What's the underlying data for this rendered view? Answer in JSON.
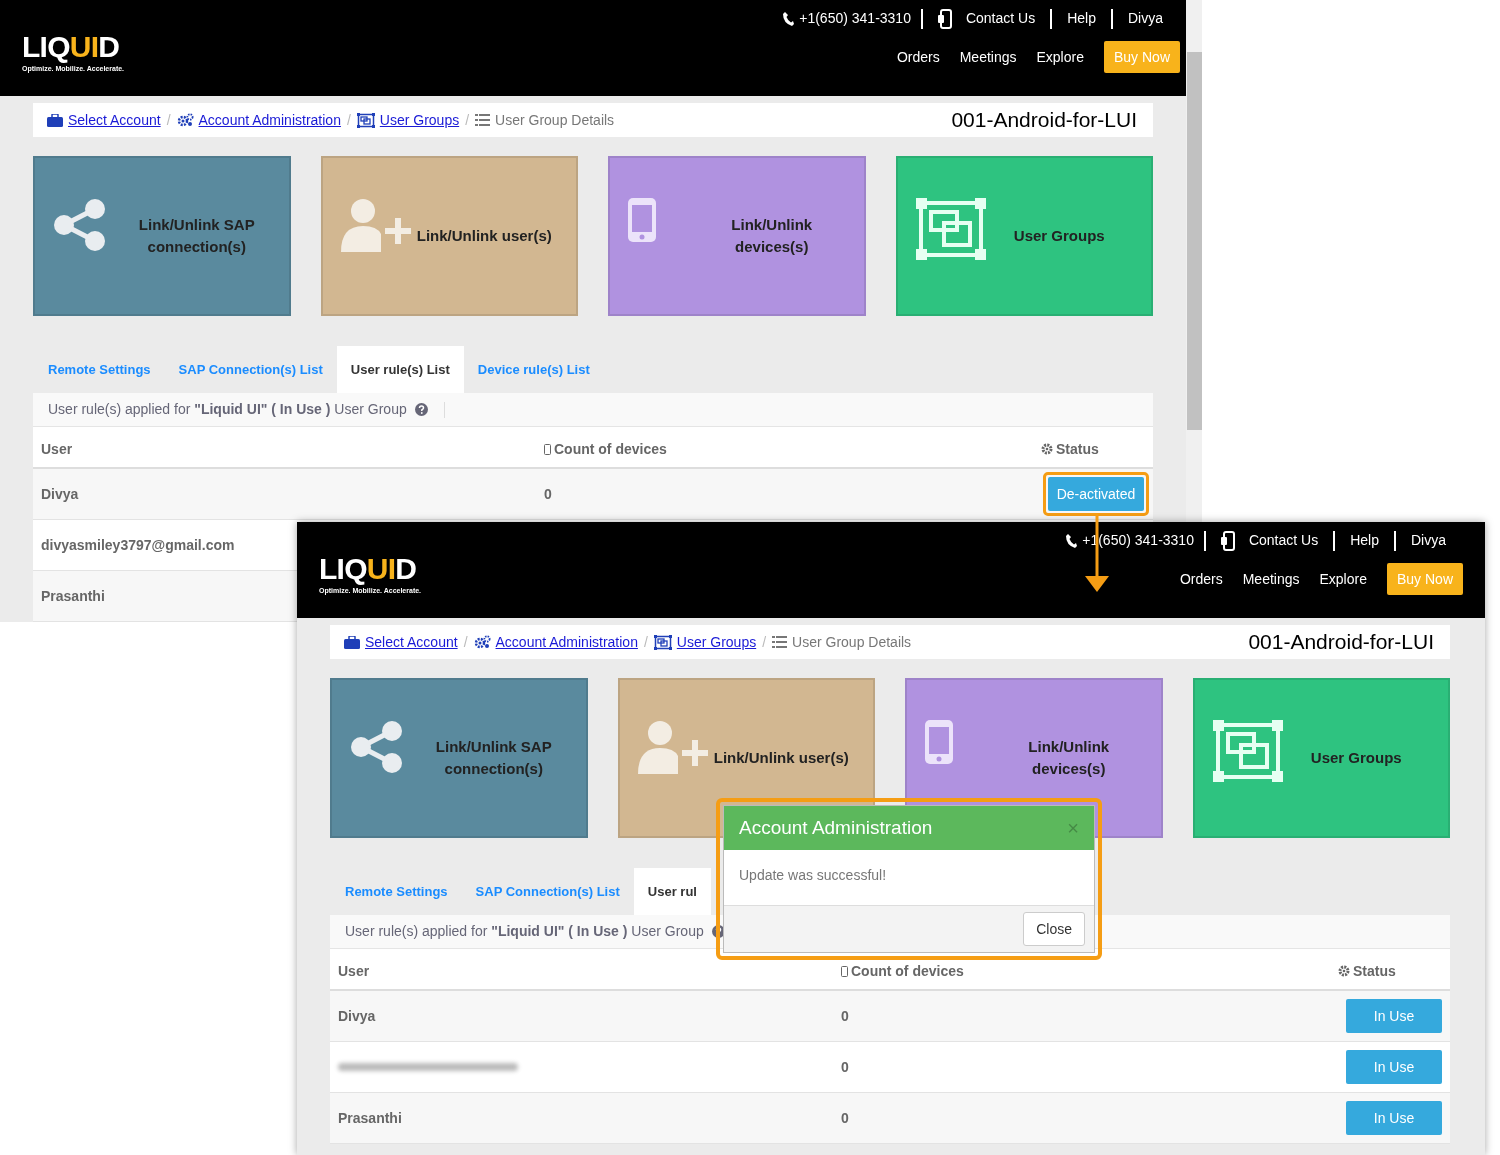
{
  "screens": [
    {
      "header": {
        "logo": {
          "parts": [
            {
              "text": "LIQ",
              "accent": false
            },
            {
              "text": "UI",
              "accent": true
            },
            {
              "text": "D",
              "accent": false
            }
          ],
          "tagline": "Optimize. Mobilize. Accelerate."
        },
        "phone": "+1(650) 341-3310",
        "links": [
          "Contact Us",
          "Help",
          "Divya"
        ],
        "nav": [
          "Orders",
          "Meetings",
          "Explore"
        ],
        "cta": "Buy Now"
      },
      "scrollbar": true,
      "breadcrumb": [
        {
          "label": "Select Account",
          "link": true
        },
        {
          "separator": "/",
          "label": "Account Administration",
          "link": true
        },
        {
          "separator": "/",
          "label": "User Groups",
          "link": true
        },
        {
          "separator": "/",
          "label": "User Group Details",
          "link": false
        }
      ],
      "title": "001-Android-for-LUI",
      "tiles": [
        {
          "label": "Link/Unlink SAP connection(s)",
          "color": "#5a8a9e"
        },
        {
          "label": "Link/Unlink user(s)",
          "color": "#d2b791"
        },
        {
          "label": "Link/Unlink devices(s)",
          "color": "#b092e0"
        },
        {
          "label": "User Groups",
          "color": "#2ec380"
        }
      ],
      "tabs": [
        {
          "label": "Remote Settings",
          "selected": false
        },
        {
          "label": "SAP Connection(s) List",
          "selected": false
        },
        {
          "label": "User rule(s) List",
          "selected": true
        },
        {
          "label": "Device rule(s) List",
          "selected": false
        }
      ],
      "info": "User rule(s) applied for **\"Liquid UI\" ( In Use )** User Group",
      "columns": [
        "User",
        "Count of devices",
        "Status"
      ],
      "rows": [
        {
          "user": "Divya",
          "count": "0",
          "status": "De-activated",
          "highlighted": true
        },
        {
          "user": "divyasmiley3797@gmail.com"
        },
        {
          "user": "Prasanthi"
        }
      ]
    },
    {
      "header": {
        "logo": {
          "parts": [
            {
              "text": "LIQ",
              "accent": false
            },
            {
              "text": "UI",
              "accent": true
            },
            {
              "text": "D",
              "accent": false
            }
          ],
          "tagline": "Optimize. Mobilize. Accelerate."
        },
        "phone": "+1(650) 341-3310",
        "links": [
          "Contact Us",
          "Help",
          "Divya"
        ],
        "nav": [
          "Orders",
          "Meetings",
          "Explore"
        ],
        "cta": "Buy Now"
      },
      "breadcrumb": [
        {
          "label": "Select Account",
          "link": true
        },
        {
          "separator": "/",
          "label": "Account Administration",
          "link": true
        },
        {
          "separator": "/",
          "label": "User Groups",
          "link": true
        },
        {
          "separator": "/",
          "label": "User Group Details",
          "link": false
        }
      ],
      "title": "001-Android-for-LUI",
      "tiles": [
        {
          "label": "Link/Unlink SAP connection(s)",
          "color": "#5a8a9e"
        },
        {
          "label": "Link/Unlink user(s)",
          "color": "#d2b791"
        },
        {
          "label": "Link/Unlink devices(s)",
          "color": "#b092e0"
        },
        {
          "label": "User Groups",
          "color": "#2ec380"
        }
      ],
      "tabs": [
        {
          "label": "Remote Settings",
          "selected": false
        },
        {
          "label": "SAP Connection(s) List",
          "selected": false
        },
        {
          "label": "User rul",
          "selected": true
        }
      ],
      "info": "User rule(s) applied for **\"Liquid UI\" ( In Use )** User Group",
      "columns": [
        "User",
        "Count of devices",
        "Status"
      ],
      "rows": [
        {
          "user": "Divya",
          "count": "0",
          "status": "In Use",
          "highlighted": false
        },
        {
          "redacted": true,
          "count": "0",
          "status": "In Use",
          "highlighted": false
        },
        {
          "user": "Prasanthi",
          "count": "0",
          "status": "In Use",
          "highlighted": false
        }
      ],
      "modal": {
        "title": "Account Administration",
        "close_glyph": "×",
        "message": "Update was successful!",
        "button": "Close",
        "highlighted": true
      }
    }
  ],
  "arrow": true
}
